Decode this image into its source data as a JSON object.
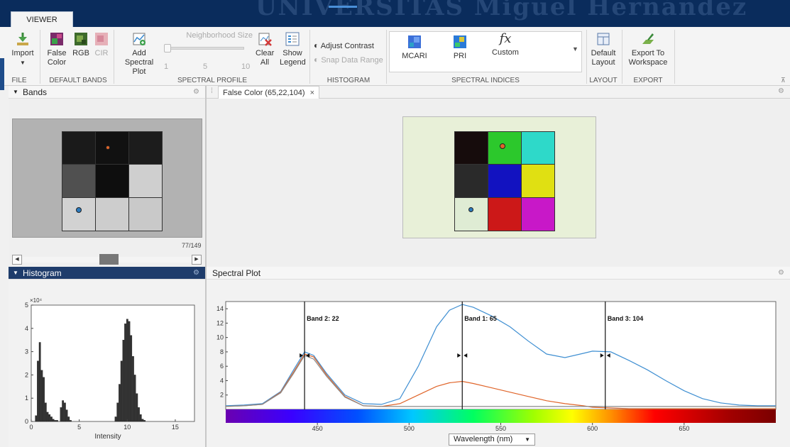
{
  "banner": {
    "watermark": "UNIVERSITAS Miguel Hernández",
    "tab": "VIEWER"
  },
  "toolstrip": {
    "file": {
      "import": "Import",
      "label": "FILE"
    },
    "default_bands": {
      "false_color": "False Color",
      "rgb": "RGB",
      "cir": "CIR",
      "label": "DEFAULT BANDS"
    },
    "spectral_profile": {
      "add_spectral_plot": "Add Spectral Plot",
      "neighborhood_size": "Neighborhood Size",
      "ticks": [
        "1",
        "5",
        "10"
      ],
      "clear_all": "Clear All",
      "show_legend": "Show Legend",
      "label": "SPECTRAL PROFILE"
    },
    "histogram": {
      "adjust_contrast": "Adjust Contrast",
      "snap_data_range": "Snap Data Range",
      "label": "HISTOGRAM"
    },
    "spectral_indices": {
      "items": [
        "MCARI",
        "PRI",
        "Custom"
      ],
      "custom_glyph": "fx",
      "label": "SPECTRAL INDICES"
    },
    "layout": {
      "default_layout": "Default Layout",
      "label": "LAYOUT"
    },
    "export": {
      "export_to_workspace": "Export To Workspace",
      "label": "EXPORT"
    }
  },
  "bands_panel": {
    "title": "Bands",
    "band_counter": "77/149"
  },
  "image_tab": {
    "title": "False Color (65,22,104)",
    "close": "×"
  },
  "histogram_panel": {
    "title": "Histogram",
    "xlabel": "Intensity",
    "y_exponent": "×10⁴"
  },
  "spectral_panel": {
    "title": "Spectral Plot",
    "unit_dropdown": "Wavelength (nm)"
  },
  "colors": {
    "banner": "#0a2c5c",
    "dark_header": "#1e3c6b",
    "orange_marker": "#e0652a",
    "blue_marker": "#2b7bbf"
  },
  "chart_data": [
    {
      "type": "bar",
      "title": "Histogram",
      "xlabel": "Intensity",
      "ylabel": "",
      "y_multiplier": "x10^4",
      "xlim": [
        0,
        17
      ],
      "ylim": [
        0,
        5
      ],
      "x_ticks": [
        "0",
        "5",
        "10",
        "15"
      ],
      "y_ticks": [
        "0",
        "1",
        "2",
        "3",
        "4",
        "5"
      ],
      "x": [
        0.5,
        0.7,
        0.9,
        1.1,
        1.3,
        1.5,
        1.7,
        1.9,
        2.1,
        2.3,
        2.5,
        2.7,
        3.1,
        3.3,
        3.5,
        3.7,
        3.9,
        4.1,
        8.8,
        9.0,
        9.2,
        9.4,
        9.6,
        9.8,
        10.0,
        10.2,
        10.4,
        10.6,
        10.8,
        11.0,
        11.2,
        11.4,
        11.6,
        11.8
      ],
      "values": [
        0.25,
        2.6,
        3.4,
        2.2,
        1.9,
        0.8,
        0.4,
        0.3,
        0.2,
        0.1,
        0.05,
        0.05,
        0.6,
        0.9,
        0.8,
        0.5,
        0.2,
        0.05,
        0.2,
        0.8,
        1.6,
        2.6,
        3.5,
        4.2,
        4.4,
        4.3,
        3.7,
        2.8,
        2.0,
        1.2,
        0.6,
        0.3,
        0.1,
        0.05
      ]
    },
    {
      "type": "line",
      "title": "Spectral Plot",
      "xlabel": "Wavelength (nm)",
      "ylabel": "",
      "xlim": [
        400,
        700
      ],
      "ylim": [
        0,
        15
      ],
      "x_ticks": [
        "450",
        "500",
        "550",
        "600",
        "650"
      ],
      "y_ticks": [
        "2",
        "4",
        "6",
        "8",
        "10",
        "12",
        "14"
      ],
      "band_markers": [
        {
          "label": "Band 2: 22",
          "x": 443
        },
        {
          "label": "Band 1: 65",
          "x": 529
        },
        {
          "label": "Band 3: 104",
          "x": 607
        }
      ],
      "series": [
        {
          "x": [
            400,
            410,
            420,
            430,
            437,
            443,
            448,
            455,
            465,
            475,
            485,
            495,
            505,
            515,
            522,
            529,
            535,
            545,
            555,
            565,
            575,
            585,
            595,
            600,
            610,
            620,
            630,
            640,
            650,
            660,
            670,
            680,
            690,
            700
          ],
          "y": [
            0.5,
            0.6,
            0.8,
            2.5,
            5.5,
            8.0,
            7.5,
            5.0,
            2.0,
            0.8,
            0.7,
            1.5,
            6.0,
            11.5,
            13.8,
            14.6,
            14.2,
            13.0,
            11.5,
            9.5,
            7.7,
            7.2,
            7.8,
            8.1,
            8.0,
            6.8,
            5.5,
            4.0,
            2.6,
            1.5,
            0.9,
            0.6,
            0.5,
            0.5
          ],
          "color": "#3f8fd2"
        },
        {
          "x": [
            400,
            410,
            420,
            430,
            437,
            443,
            448,
            455,
            465,
            475,
            485,
            495,
            505,
            515,
            522,
            529,
            535,
            545,
            555,
            565,
            575,
            585,
            595,
            600,
            610,
            620,
            630,
            640,
            650,
            660,
            670,
            680,
            690,
            700
          ],
          "y": [
            0.4,
            0.5,
            0.7,
            2.4,
            5.2,
            7.7,
            7.3,
            4.8,
            1.8,
            0.5,
            0.4,
            0.8,
            2.0,
            3.2,
            3.7,
            3.9,
            3.6,
            3.0,
            2.4,
            1.8,
            1.2,
            0.8,
            0.5,
            0.3,
            0.2,
            0.1,
            0.1,
            0.1,
            0.1,
            0.1,
            0.1,
            0.1,
            0.1,
            0.1
          ],
          "color": "#e0652a"
        },
        {
          "x": [
            400,
            410,
            420,
            430,
            437,
            443,
            448,
            455,
            465,
            475,
            485,
            495,
            505,
            515,
            522,
            529,
            535,
            545,
            555,
            565,
            575,
            585,
            595,
            600,
            610,
            620,
            630,
            640,
            650,
            660,
            670,
            680,
            690,
            700
          ],
          "y": [
            0.4,
            0.5,
            0.7,
            2.3,
            5.0,
            7.5,
            7.0,
            4.6,
            1.7,
            0.5,
            0.4,
            0.4,
            0.4,
            0.4,
            0.4,
            0.4,
            0.4,
            0.4,
            0.4,
            0.4,
            0.4,
            0.4,
            0.4,
            0.4,
            0.4,
            0.4,
            0.4,
            0.4,
            0.4,
            0.4,
            0.4,
            0.4,
            0.4,
            0.4
          ],
          "color": "#8a8a8a"
        }
      ]
    }
  ]
}
